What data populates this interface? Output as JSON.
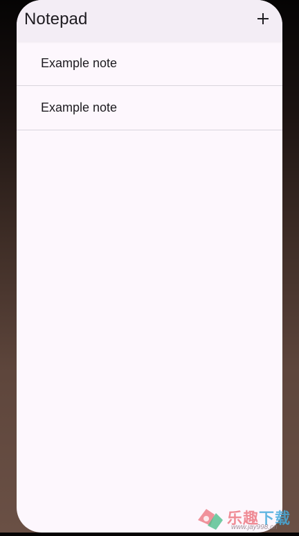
{
  "app": {
    "title": "Notepad",
    "add_label": "+"
  },
  "notes": [
    {
      "title": "Example note"
    },
    {
      "title": "Example note"
    }
  ],
  "watermark": {
    "text_part1": "乐趣",
    "text_part2": "下载",
    "url": "www.jay998.cn"
  },
  "colors": {
    "app_bar": "#f3edf5",
    "surface": "#fdf7fd",
    "text": "#1d1b20",
    "divider": "#d9d4dc"
  }
}
